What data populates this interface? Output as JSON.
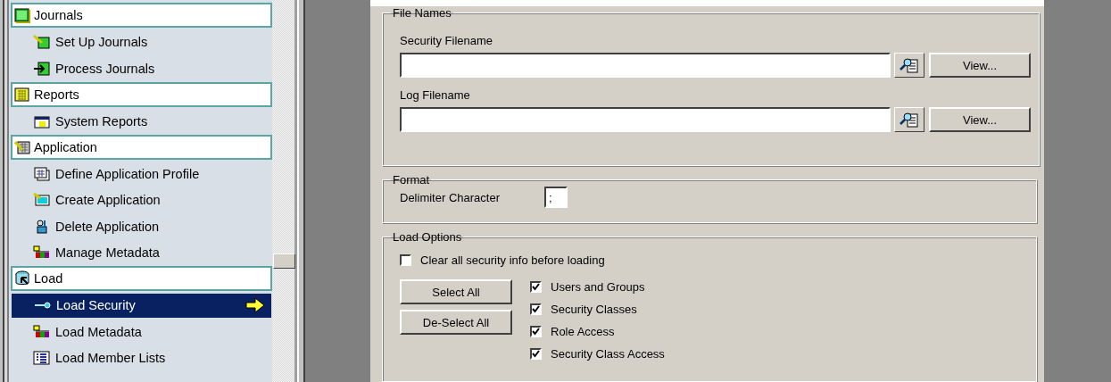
{
  "sidebar": {
    "groups": [
      {
        "label": "Journals",
        "items": [
          {
            "label": "Set Up Journals",
            "selected": false
          },
          {
            "label": "Process Journals",
            "selected": false
          }
        ]
      },
      {
        "label": "Reports",
        "items": [
          {
            "label": "System Reports",
            "selected": false
          }
        ]
      },
      {
        "label": "Application",
        "items": [
          {
            "label": "Define Application Profile",
            "selected": false
          },
          {
            "label": "Create Application",
            "selected": false
          },
          {
            "label": "Delete Application",
            "selected": false
          },
          {
            "label": "Manage Metadata",
            "selected": false
          }
        ]
      },
      {
        "label": "Load",
        "items": [
          {
            "label": "Load Security",
            "selected": true
          },
          {
            "label": "Load Metadata",
            "selected": false
          },
          {
            "label": "Load Member Lists",
            "selected": false
          }
        ]
      }
    ]
  },
  "file_names": {
    "title": "File Names",
    "fields": [
      {
        "label": "Security Filename",
        "button": "View..."
      },
      {
        "label": "Log Filename",
        "button": "View..."
      }
    ]
  },
  "format": {
    "title": "Format",
    "label": "Delimiter Character",
    "value": ";"
  },
  "load_options": {
    "title": "Load Options",
    "clear": {
      "label": "Clear all security info before loading",
      "checked": false
    },
    "buttons": [
      "Select All",
      "De-Select All"
    ],
    "options": [
      {
        "label": "Users and Groups",
        "checked": true
      },
      {
        "label": "Security Classes",
        "checked": true
      },
      {
        "label": "Role Access",
        "checked": true
      },
      {
        "label": "Security Class Access",
        "checked": true
      }
    ]
  }
}
